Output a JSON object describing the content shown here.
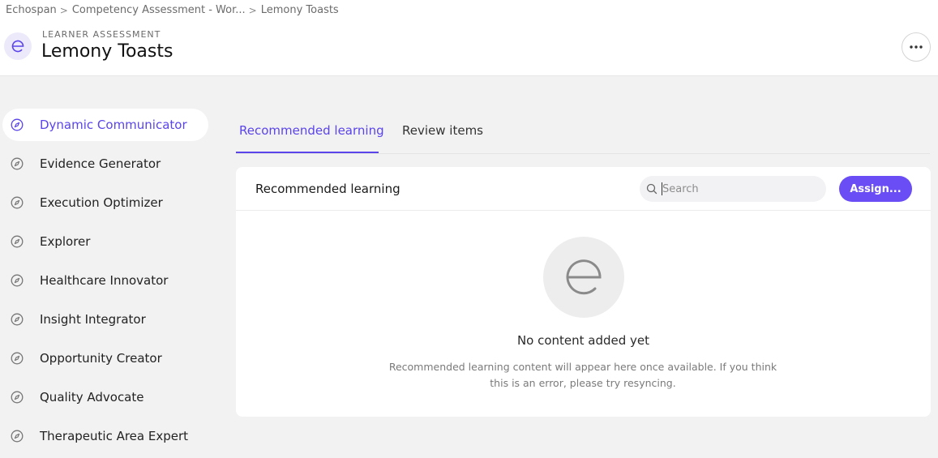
{
  "breadcrumb": [
    "Echospan",
    "Competency Assessment - Wor...",
    "Lemony Toasts"
  ],
  "header": {
    "subtitle": "LEARNER ASSESSMENT",
    "title": "Lemony Toasts",
    "logo_icon": "echospan-e-icon",
    "more_icon": "more-horizontal-icon"
  },
  "sidebar": {
    "items": [
      {
        "label": "Dynamic Communicator",
        "active": true
      },
      {
        "label": "Evidence Generator"
      },
      {
        "label": "Execution Optimizer"
      },
      {
        "label": "Explorer"
      },
      {
        "label": "Healthcare Innovator"
      },
      {
        "label": "Insight Integrator"
      },
      {
        "label": "Opportunity Creator"
      },
      {
        "label": "Quality Advocate"
      },
      {
        "label": "Therapeutic Area Expert"
      }
    ],
    "item_icon": "compass-icon"
  },
  "tabs": [
    {
      "label": "Recommended learning",
      "active": true
    },
    {
      "label": "Review items"
    }
  ],
  "panel": {
    "title": "Recommended learning",
    "search_placeholder": "Search",
    "search_value": "",
    "assign_label": "Assign...",
    "empty_title": "No content added yet",
    "empty_desc": "Recommended learning content will appear here once available. If you think this is an error, please try resyncing."
  },
  "colors": {
    "accent": "#5a44ea",
    "button": "#6a4df4",
    "background": "#f2f2f2"
  }
}
